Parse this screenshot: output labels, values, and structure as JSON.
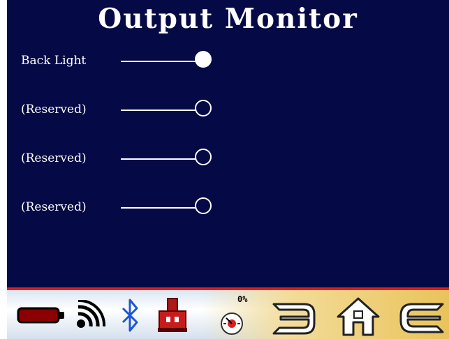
{
  "header": {
    "title": "Output Monitor"
  },
  "outputs": [
    {
      "label": "Back Light",
      "state": "on"
    },
    {
      "label": "(Reserved)",
      "state": "off"
    },
    {
      "label": "(Reserved)",
      "state": "off"
    },
    {
      "label": "(Reserved)",
      "state": "off"
    }
  ],
  "taskbar": {
    "battery_icon": "battery-icon",
    "signal_icon": "wireless-signal-icon",
    "bluetooth_icon": "bluetooth-icon",
    "usb_icon": "usb-connector-icon",
    "gauge_percent": "0%",
    "buttons": [
      "menu-button",
      "home-button",
      "back-button"
    ]
  },
  "colors": {
    "screen_bg": "#050a46",
    "accent_red": "#d82020",
    "text": "#ffffff"
  }
}
